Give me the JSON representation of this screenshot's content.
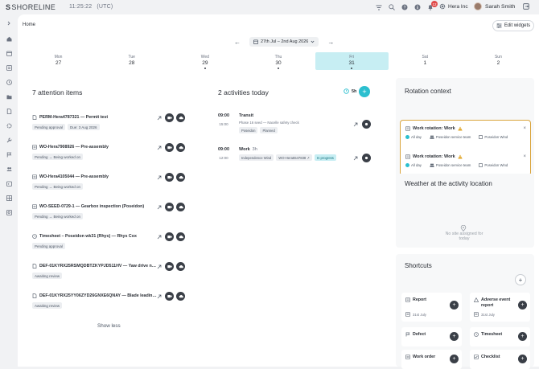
{
  "header": {
    "logo_prefix": "S",
    "logo_text": "SHORELINE",
    "time": "11:25:22",
    "timezone": "(UTC)",
    "notification_count": "12",
    "org_name": "Hera Inc",
    "user_name": "Sarah Smith"
  },
  "page": {
    "breadcrumb": "Home",
    "edit_widgets_label": "Edit widgets",
    "date_range": "27th Jul – 2nd Aug 2026"
  },
  "week": [
    {
      "dow": "Mon",
      "num": "27",
      "dot": false,
      "selected": false
    },
    {
      "dow": "Tue",
      "num": "28",
      "dot": false,
      "selected": false
    },
    {
      "dow": "Wed",
      "num": "29",
      "dot": true,
      "selected": false
    },
    {
      "dow": "Thu",
      "num": "30",
      "dot": true,
      "selected": false
    },
    {
      "dow": "Fri",
      "num": "31",
      "dot": true,
      "selected": true
    },
    {
      "dow": "Sat",
      "num": "1",
      "dot": false,
      "selected": false
    },
    {
      "dow": "Sun",
      "num": "2",
      "dot": false,
      "selected": false
    }
  ],
  "attention": {
    "title": "7 attention items",
    "show_less": "Show less",
    "items": [
      {
        "icon": "document",
        "title": "PERM-Hera4787321 — Permit test",
        "tags": [
          "Pending approval",
          "Due: 3 Aug 2026"
        ]
      },
      {
        "icon": "workorder",
        "title": "WO-Hera7908926 — Pre-assembly",
        "tags": [
          "Pending → Being worked on"
        ]
      },
      {
        "icon": "workorder",
        "title": "WO-Hera4105044 — Pre-assembly",
        "tags": [
          "Pending → Being worked on"
        ]
      },
      {
        "icon": "workorder",
        "title": "WO-SEED-0729-1 — Gearbox inspection (Poseidon)",
        "tags": [
          "Pending → Being worked on"
        ]
      },
      {
        "icon": "clock",
        "title": "Timesheet – Poseidon wk31 (Rhys) — Rhys Cox",
        "tags": [
          "Pending approval"
        ]
      },
      {
        "icon": "document",
        "title": "DEF-01KYRX25RSMQDBTZKYPJD511HV — Yaw drive noise (...",
        "tags": [
          "Awaiting review"
        ]
      },
      {
        "icon": "document",
        "title": "DEF-01KYRX25YY06ZYD26GNXE6QNAY — Blade leading-e...",
        "tags": [
          "Awaiting review"
        ]
      }
    ]
  },
  "activities": {
    "title": "2 activities today",
    "timer": "5h",
    "items": [
      {
        "start": "09:00",
        "end": "15:00",
        "name": "Transit",
        "duration": "",
        "sub": "Phase 16 seed — Nacelle safety check",
        "tags": [
          {
            "label": "Poseidon",
            "kind": "plain"
          },
          {
            "label": "Planned",
            "kind": "plain"
          }
        ]
      },
      {
        "start": "09:00",
        "end": "12:00",
        "name": "Work",
        "duration": "3h",
        "sub": "",
        "tags": [
          {
            "label": "Independence Wind",
            "kind": "plain"
          },
          {
            "label": "WO-Hera5547838 ↗",
            "kind": "plain"
          },
          {
            "label": "In progress",
            "kind": "prog"
          }
        ]
      }
    ]
  },
  "rotation": {
    "title": "Rotation context",
    "items": [
      {
        "title": "Work rotation: Work",
        "when": "All day",
        "team": "Poseidon service team",
        "site": "Poseidon Wind"
      },
      {
        "title": "Work rotation: Work",
        "when": "All day",
        "team": "Poseidon service team",
        "site": "Poseidon Wind"
      }
    ]
  },
  "weather": {
    "title": "Weather at the activity location",
    "empty": "No site assigned for today"
  },
  "shortcuts": {
    "title": "Shortcuts",
    "items": [
      {
        "label": "Report",
        "date": "31st July",
        "icon": "report"
      },
      {
        "label": "Adverse event report",
        "date": "31st July",
        "icon": "warning"
      },
      {
        "label": "Defect",
        "date": "",
        "icon": "flag"
      },
      {
        "label": "Timesheet",
        "date": "",
        "icon": "clock"
      },
      {
        "label": "Work order",
        "date": "",
        "icon": "workorder"
      },
      {
        "label": "Checklist",
        "date": "",
        "icon": "check"
      }
    ]
  },
  "colors": {
    "accent": "#2bbfcf",
    "selected_day": "#c7eef3",
    "rotation_border": "#d9a43c",
    "warning": "#e0a526",
    "dark_button": "#3a3f47"
  }
}
